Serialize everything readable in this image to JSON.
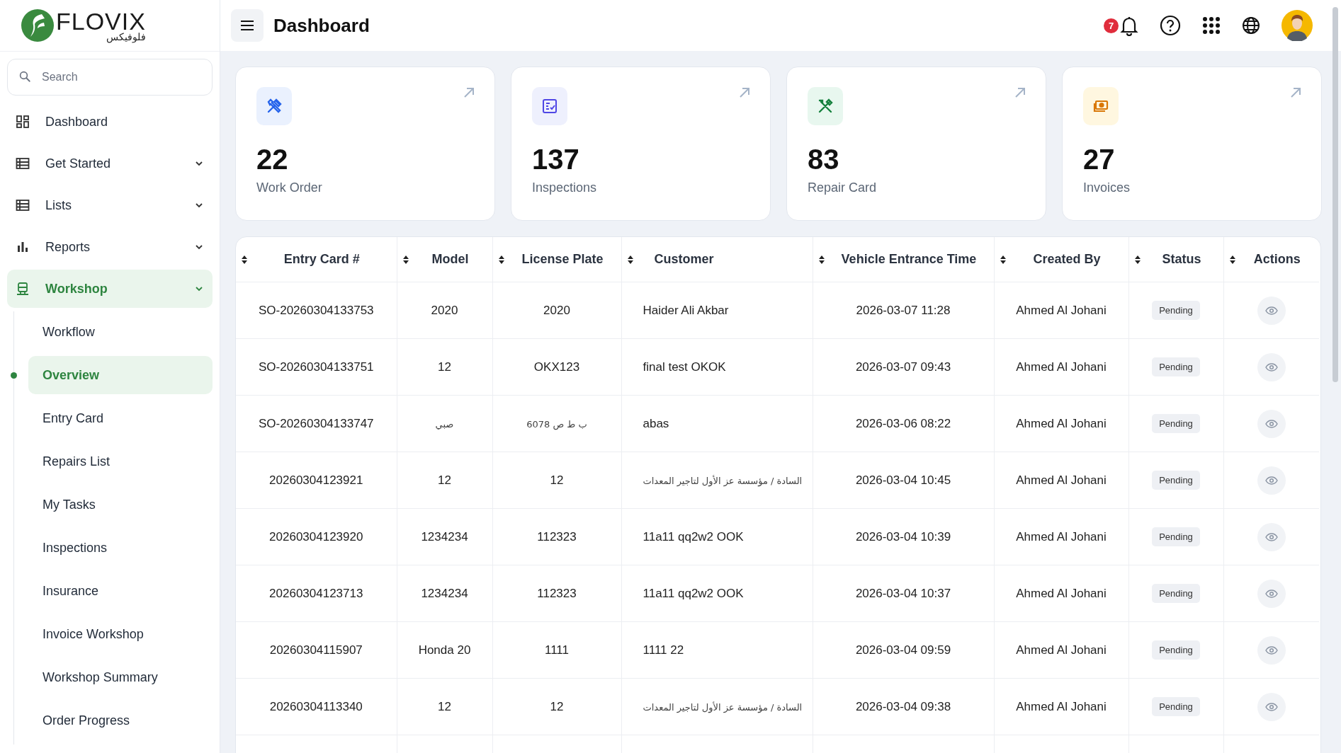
{
  "logo": {
    "name": "FLOVIX",
    "subtitle": "فلوفيكس"
  },
  "header": {
    "title": "Dashboard",
    "notification_count": "7"
  },
  "search": {
    "placeholder": "Search"
  },
  "sidebar": {
    "items": [
      {
        "label": "Dashboard",
        "selected": false,
        "kind": "link"
      },
      {
        "label": "Get Started",
        "selected": false,
        "kind": "group"
      },
      {
        "label": "Lists",
        "selected": false,
        "kind": "group"
      },
      {
        "label": "Reports",
        "selected": false,
        "kind": "group"
      },
      {
        "label": "Workshop",
        "selected": true,
        "kind": "group",
        "children": [
          {
            "label": "Workflow",
            "selected": false
          },
          {
            "label": "Overview",
            "selected": true
          },
          {
            "label": "Entry Card",
            "selected": false
          },
          {
            "label": "Repairs List",
            "selected": false
          },
          {
            "label": "My Tasks",
            "selected": false
          },
          {
            "label": "Inspections",
            "selected": false
          },
          {
            "label": "Insurance",
            "selected": false
          },
          {
            "label": "Invoice Workshop",
            "selected": false
          },
          {
            "label": "Workshop Summary",
            "selected": false
          },
          {
            "label": "Order Progress",
            "selected": false
          }
        ]
      }
    ]
  },
  "cards": [
    {
      "value": "22",
      "label": "Work Order",
      "color": "#2563eb"
    },
    {
      "value": "137",
      "label": "Inspections",
      "color": "#4f46e5"
    },
    {
      "value": "83",
      "label": "Repair Card",
      "color": "#15803d"
    },
    {
      "value": "27",
      "label": "Invoices",
      "color": "#d97706"
    }
  ],
  "table": {
    "columns": [
      "Entry Card #",
      "Model",
      "License Plate",
      "Customer",
      "Vehicle Entrance Time",
      "Created By",
      "Status",
      "Actions"
    ],
    "rows": [
      {
        "cells": [
          "SO-20260304133753",
          "2020",
          "2020",
          "Haider Ali Akbar",
          "2026-03-07 11:28",
          "Ahmed Al Johani"
        ],
        "status": "Pending"
      },
      {
        "cells": [
          "SO-20260304133751",
          "12",
          "OKX123",
          "final test OKOK",
          "2026-03-07 09:43",
          "Ahmed Al Johani"
        ],
        "status": "Pending"
      },
      {
        "cells": [
          "SO-20260304133747",
          "صبي",
          "ب ط ص 6078",
          "abas",
          "2026-03-06 08:22",
          "Ahmed Al Johani"
        ],
        "status": "Pending"
      },
      {
        "cells": [
          "20260304123921",
          "12",
          "12",
          "السادة / مؤسسة عز الأول لتاجير المعدات",
          "2026-03-04 10:45",
          "Ahmed Al Johani"
        ],
        "status": "Pending"
      },
      {
        "cells": [
          "20260304123920",
          "1234234",
          "112323",
          "11a11 qq2w2 OOK",
          "2026-03-04 10:39",
          "Ahmed Al Johani"
        ],
        "status": "Pending"
      },
      {
        "cells": [
          "20260304123713",
          "1234234",
          "112323",
          "11a11 qq2w2 OOK",
          "2026-03-04 10:37",
          "Ahmed Al Johani"
        ],
        "status": "Pending"
      },
      {
        "cells": [
          "20260304115907",
          "Honda 20",
          "1111",
          "1111 22",
          "2026-03-04 09:59",
          "Ahmed Al Johani"
        ],
        "status": "Pending"
      },
      {
        "cells": [
          "20260304113340",
          "12",
          "12",
          "السادة / مؤسسة عز الأول لتاجير المعدات",
          "2026-03-04 09:38",
          "Ahmed Al Johani"
        ],
        "status": "Pending"
      }
    ]
  }
}
